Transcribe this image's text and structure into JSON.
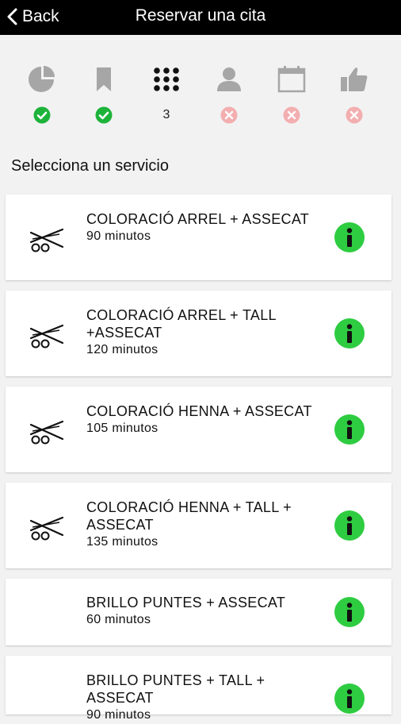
{
  "header": {
    "back_label": "Back",
    "title": "Reservar una cita"
  },
  "steps": [
    {
      "icon": "pie-chart-icon",
      "status": "done"
    },
    {
      "icon": "bookmark-icon",
      "status": "done"
    },
    {
      "icon": "grid-icon",
      "status": "current",
      "number": "3"
    },
    {
      "icon": "person-icon",
      "status": "pending"
    },
    {
      "icon": "calendar-icon",
      "status": "pending"
    },
    {
      "icon": "thumbs-up-icon",
      "status": "pending"
    }
  ],
  "section_title": "Selecciona un servicio",
  "services": [
    {
      "name": "COLORACIÓ ARREL + ASSECAT",
      "duration": "90 minutos"
    },
    {
      "name": "COLORACIÓ ARREL + TALL +ASSECAT",
      "duration": "120 minutos"
    },
    {
      "name": "COLORACIÓ HENNA + ASSECAT",
      "duration": "105 minutos"
    },
    {
      "name": "COLORACIÓ HENNA + TALL + ASSECAT",
      "duration": "135 minutos"
    },
    {
      "name": "BRILLO PUNTES + ASSECAT",
      "duration": "60 minutos"
    },
    {
      "name": "BRILLO PUNTES + TALL + ASSECAT",
      "duration": "90 minutos"
    }
  ],
  "colors": {
    "done": "#1db33a",
    "pending": "#f3aeb0",
    "info": "#2ecc40",
    "icon_gray": "#a6a6a6"
  }
}
